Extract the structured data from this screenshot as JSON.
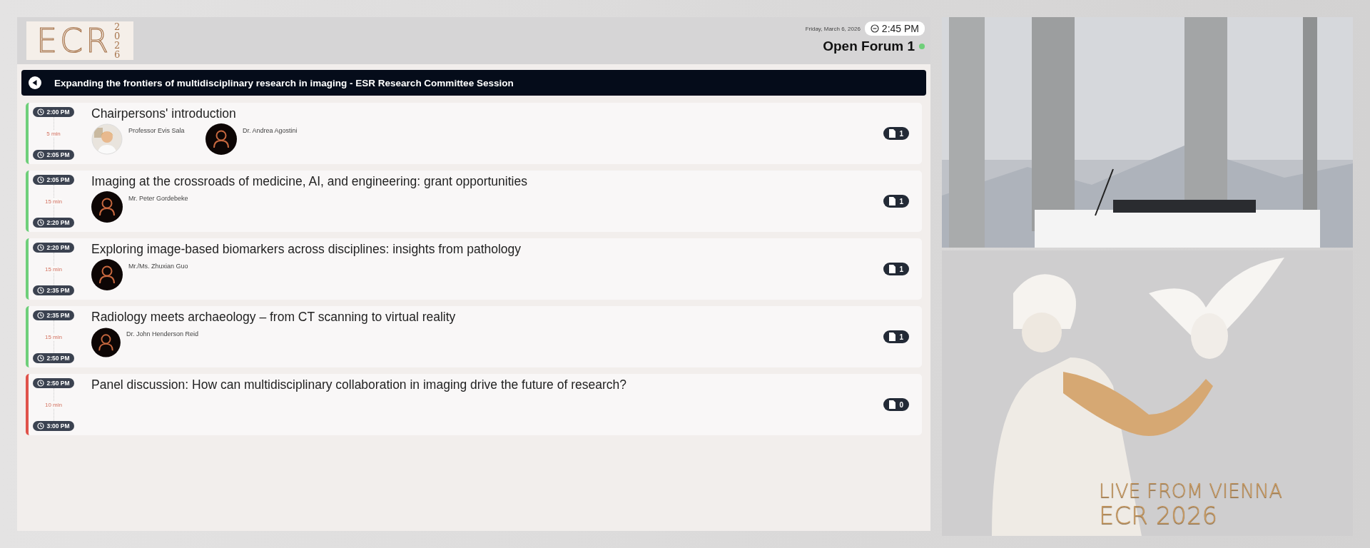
{
  "header": {
    "logo": {
      "letters": "ECR",
      "year": "2026"
    },
    "date": "Friday, March 6, 2026",
    "time": "2:45 PM",
    "room": "Open Forum 1",
    "room_live": true
  },
  "session": {
    "title": "Expanding the frontiers of multidisciplinary research in imaging - ESR Research Committee Session"
  },
  "talks": [
    {
      "start": "2:00 PM",
      "duration": "5 min",
      "end": "2:05 PM",
      "title": "Chairpersons' introduction",
      "color": "#6fcf7a",
      "documents": "1",
      "speakers": [
        {
          "name": "Professor Evis Sala"
        },
        {
          "name": "Dr. Andrea Agostini",
          "kind": "placeholder"
        }
      ]
    },
    {
      "start": "2:05 PM",
      "duration": "15 min",
      "end": "2:20 PM",
      "title": "Imaging at the crossroads of medicine, AI, and engineering: grant opportunities",
      "color": "#6fcf7a",
      "documents": "1",
      "speakers": [
        {
          "name": "Mr. Peter Gordebeke",
          "kind": "placeholder"
        }
      ]
    },
    {
      "start": "2:20 PM",
      "duration": "15 min",
      "end": "2:35 PM",
      "title": "Exploring image-based biomarkers across disciplines: insights from pathology",
      "color": "#6fcf7a",
      "documents": "1",
      "speakers": [
        {
          "name": "Mr./Ms. Zhuxian Guo",
          "kind": "placeholder"
        }
      ]
    },
    {
      "start": "2:35 PM",
      "duration": "15 min",
      "end": "2:50 PM",
      "title": "Radiology meets archaeology – from CT scanning to virtual reality",
      "color": "#6fcf7a",
      "documents": "1",
      "speakers": [
        {
          "name": "Dr. John Henderson Reid",
          "kind": "placeholder"
        }
      ]
    },
    {
      "start": "2:50 PM",
      "duration": "10 min",
      "end": "3:00 PM",
      "title": "Panel discussion: How can multidisciplinary collaboration in imaging drive the future of research?",
      "color": "#e0524a",
      "documents": "0"
    }
  ],
  "stream": {
    "banner": {
      "kind": "picture",
      "line_1": "LIVE FROM VIENNA",
      "line_2": "ECR 2026"
    }
  }
}
